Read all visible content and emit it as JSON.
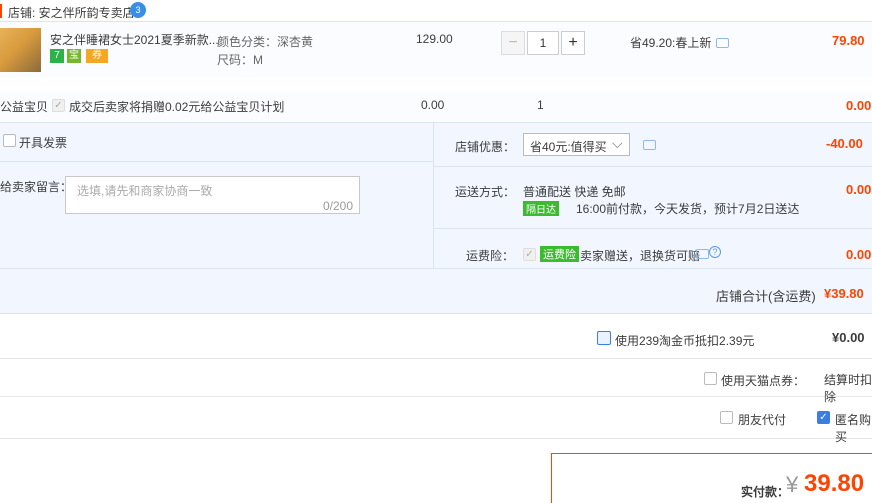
{
  "store": {
    "label": "店铺: 安之伴所韵专卖店",
    "badge": "3"
  },
  "item": {
    "title": "安之伴睡裙女士2021夏季新款...",
    "icons": [
      "7",
      "宝",
      "券"
    ],
    "sku_color": "颜色分类：深杏黄",
    "sku_size": "尺码：M",
    "price": "129.00",
    "qty_minus": "−",
    "qty": "1",
    "qty_plus": "+",
    "saving": "省49.20:春上新",
    "subtotal": "79.80"
  },
  "charity": {
    "label": "公益宝贝",
    "text": "成交后卖家将捐赠0.02元给公益宝贝计划",
    "price": "0.00",
    "qty": "1",
    "subtotal": "0.00"
  },
  "invoice": {
    "label": "开具发票"
  },
  "message": {
    "label": "给卖家留言：",
    "placeholder": "选填,请先和商家协商一致",
    "counter": "0/200"
  },
  "discount": {
    "label": "店铺优惠：",
    "selected": "省40元:值得买",
    "amount": "-40.00"
  },
  "shipping": {
    "label": "运送方式：",
    "method": "普通配送 快递 免邮",
    "tag": "隔日达",
    "note": "16:00前付款，今天发货，预计7月2日送达",
    "amount": "0.00"
  },
  "insurance": {
    "label": "运费险：",
    "tag": "运费险",
    "text": "卖家赠送，退换货可赔",
    "amount": "0.00"
  },
  "store_total": {
    "label": "店铺合计(含运费)",
    "amount": "¥39.80"
  },
  "coins": {
    "text": "使用239淘金币抵扣2.39元",
    "amount": "¥0.00"
  },
  "tmall_coupon": {
    "text": "使用天猫点券：",
    "note": "结算时扣除"
  },
  "friend_pay": {
    "text": "朋友代付"
  },
  "anonymous": {
    "text": "匿名购买"
  },
  "pay": {
    "label": "实付款：",
    "currency": "¥",
    "amount": "39.80"
  },
  "colors": {
    "accent": "#ff4400",
    "link_blue": "#3a7fe0",
    "panel_bg": "#f2f7ff"
  }
}
